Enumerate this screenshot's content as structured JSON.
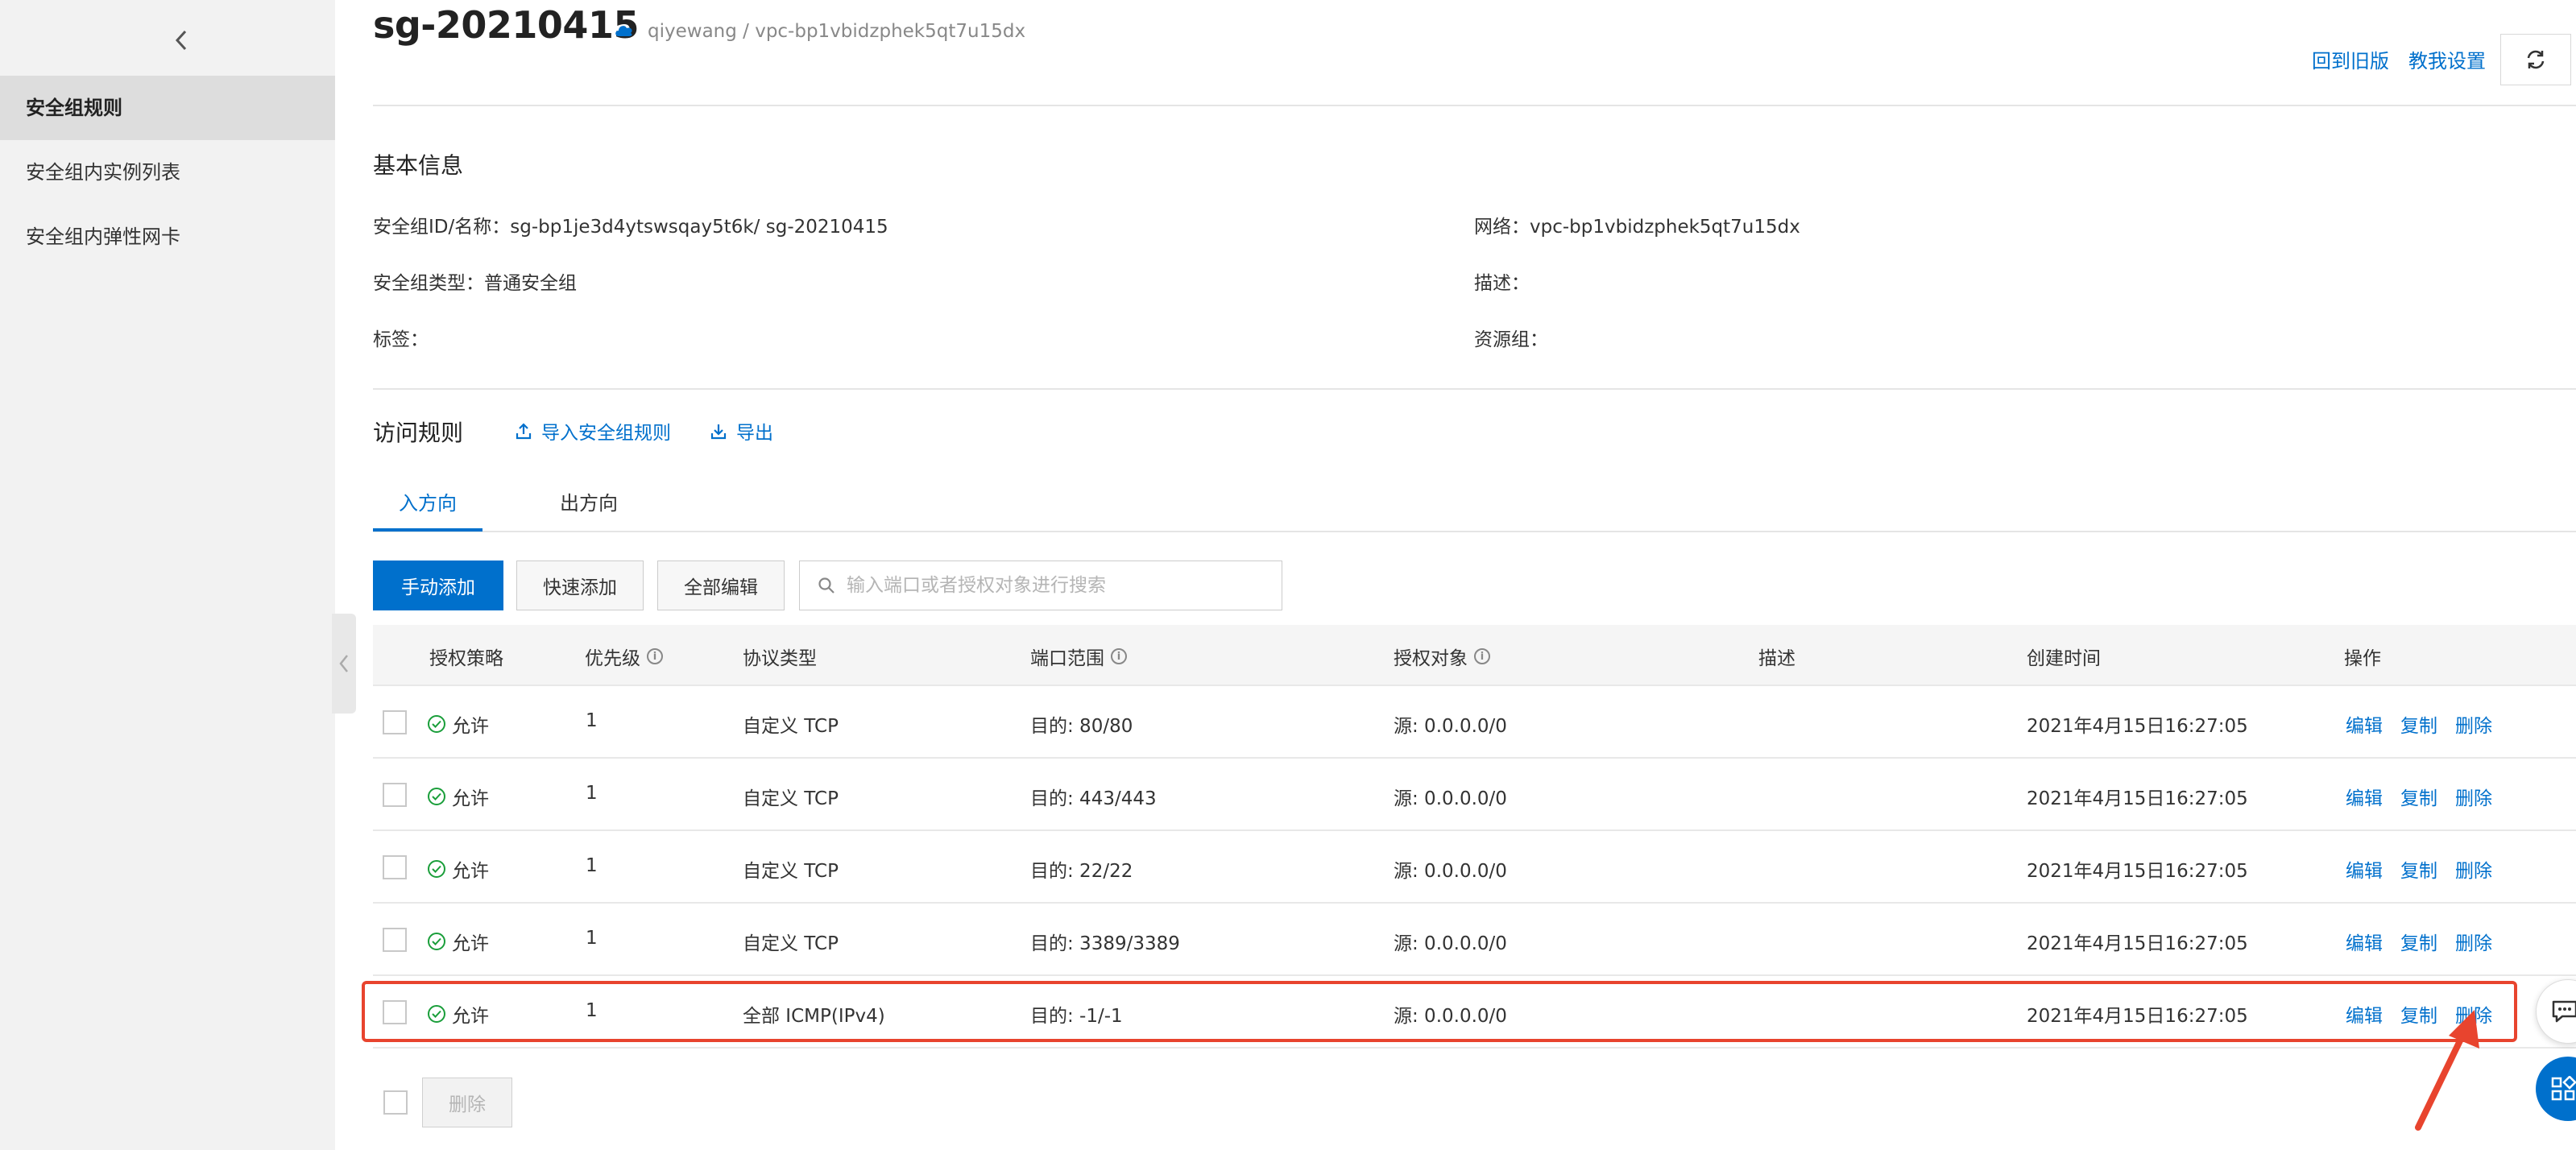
{
  "sidebar": {
    "items": [
      {
        "label": "安全组规则",
        "active": true
      },
      {
        "label": "安全组内实例列表",
        "active": false
      },
      {
        "label": "安全组内弹性网卡",
        "active": false
      }
    ]
  },
  "header": {
    "title": "sg-20210415",
    "subtitle": "qiyewang / vpc-bp1vbidzphek5qt7u15dx",
    "link_old": "回到旧版",
    "link_tutorial": "教我设置"
  },
  "basic_info": {
    "title": "基本信息",
    "id_label": "安全组ID/名称：",
    "id_value": "sg-bp1je3d4ytswsqay5t6k/ sg-20210415",
    "type_label": "安全组类型：",
    "type_value": "普通安全组",
    "tag_label": "标签：",
    "network_label": "网络：",
    "network_value": "vpc-bp1vbidzphek5qt7u15dx",
    "desc_label": "描述：",
    "resource_label": "资源组："
  },
  "rules": {
    "title": "访问规则",
    "import_label": "导入安全组规则",
    "export_label": "导出",
    "tabs": [
      {
        "label": "入方向",
        "active": true
      },
      {
        "label": "出方向",
        "active": false
      }
    ],
    "buttons": {
      "manual_add": "手动添加",
      "quick_add": "快速添加",
      "edit_all": "全部编辑"
    },
    "search_placeholder": "输入端口或者授权对象进行搜索",
    "columns": [
      "授权策略",
      "优先级",
      "协议类型",
      "端口范围",
      "授权对象",
      "描述",
      "创建时间",
      "操作"
    ],
    "rows": [
      {
        "policy": "允许",
        "priority": "1",
        "protocol": "自定义 TCP",
        "port": "目的: 80/80",
        "source": "源: 0.0.0.0/0",
        "desc": "",
        "created": "2021年4月15日16:27:05"
      },
      {
        "policy": "允许",
        "priority": "1",
        "protocol": "自定义 TCP",
        "port": "目的: 443/443",
        "source": "源: 0.0.0.0/0",
        "desc": "",
        "created": "2021年4月15日16:27:05"
      },
      {
        "policy": "允许",
        "priority": "1",
        "protocol": "自定义 TCP",
        "port": "目的: 22/22",
        "source": "源: 0.0.0.0/0",
        "desc": "",
        "created": "2021年4月15日16:27:05"
      },
      {
        "policy": "允许",
        "priority": "1",
        "protocol": "自定义 TCP",
        "port": "目的: 3389/3389",
        "source": "源: 0.0.0.0/0",
        "desc": "",
        "created": "2021年4月15日16:27:05"
      },
      {
        "policy": "允许",
        "priority": "1",
        "protocol": "全部 ICMP(IPv4)",
        "port": "目的: -1/-1",
        "source": "源: 0.0.0.0/0",
        "desc": "",
        "created": "2021年4月15日16:27:05"
      }
    ],
    "ops": {
      "edit": "编辑",
      "copy": "复制",
      "delete": "删除"
    },
    "footer_delete": "删除"
  },
  "colors": {
    "accent": "#0070cc",
    "highlight": "#e8442e",
    "success": "#1a9e3a"
  },
  "icons": [
    "chevron-left-icon",
    "cloud-icon",
    "refresh-icon",
    "upload-icon",
    "download-icon",
    "search-icon",
    "info-icon",
    "check-circle-icon",
    "chat-icon",
    "apps-icon"
  ]
}
